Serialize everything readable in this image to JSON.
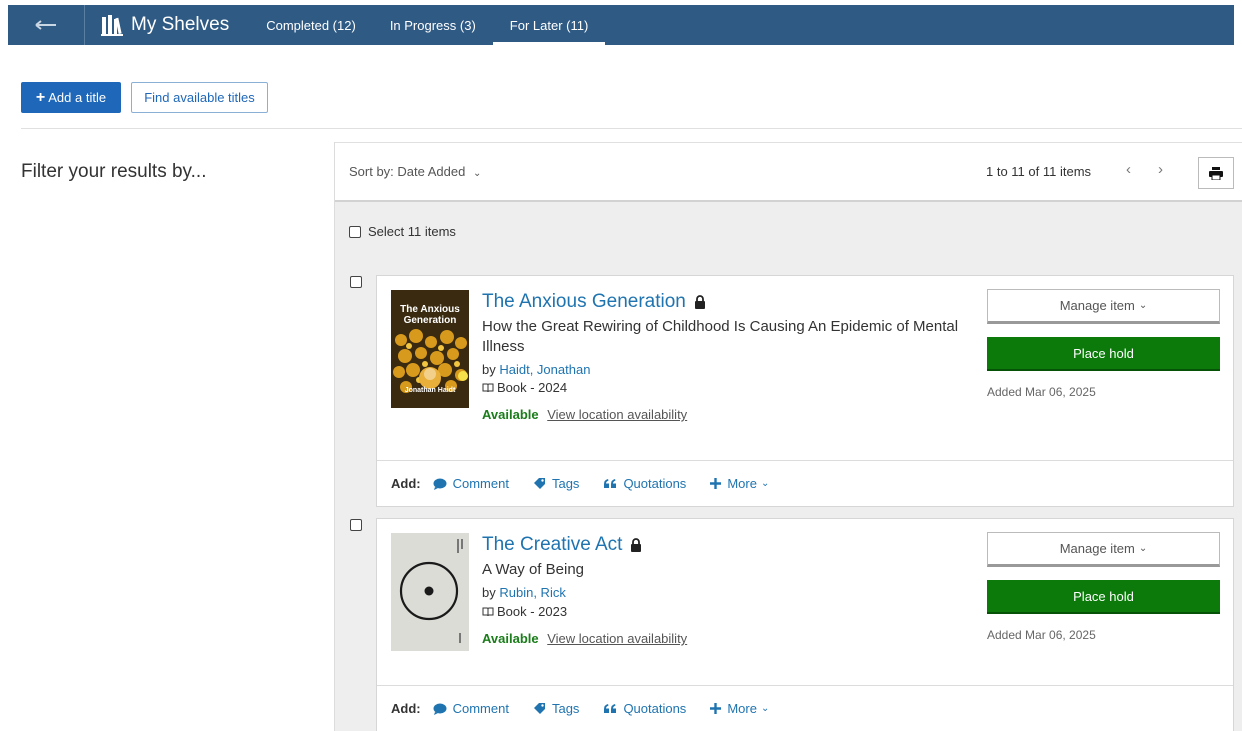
{
  "nav": {
    "brand": "My Shelves",
    "tabs": [
      "Completed (12)",
      "In Progress (3)",
      "For Later (11)"
    ],
    "active_tab": 2
  },
  "actions": {
    "add_title": "Add a title",
    "find_titles": "Find available titles"
  },
  "filter": {
    "heading": "Filter your results by..."
  },
  "results": {
    "sort_label": "Sort by: Date Added",
    "pager_count": "1 to 11 of 11 items",
    "select_all": "Select 11 items",
    "items": [
      {
        "title": "The Anxious Generation",
        "subtitle": "How the Great Rewiring of Childhood Is Causing An Epidemic of Mental Illness",
        "by": "by",
        "author": "Haidt, Jonathan",
        "format": "Book - 2024",
        "status": "Available",
        "availability_link": "View location availability",
        "manage": "Manage item",
        "hold": "Place hold",
        "added": "Added Mar 06, 2025",
        "cover_text": {
          "line1": "The Anxious",
          "line2": "Generation",
          "author": "Jonathan Haidt"
        }
      },
      {
        "title": "The Creative Act",
        "subtitle": "A Way of Being",
        "by": "by",
        "author": "Rubin, Rick",
        "format": "Book - 2023",
        "status": "Available",
        "availability_link": "View location availability",
        "manage": "Manage item",
        "hold": "Place hold",
        "added": "Added Mar 06, 2025"
      }
    ],
    "footer": {
      "add_label": "Add:",
      "comment": "Comment",
      "tags": "Tags",
      "quotations": "Quotations",
      "more": "More"
    }
  },
  "colors": {
    "nav_bg": "#2f5a84",
    "primary": "#1f67b8",
    "link": "#1f74b0",
    "hold_green": "#0b7a0b",
    "available_green": "#1a7d1a"
  }
}
